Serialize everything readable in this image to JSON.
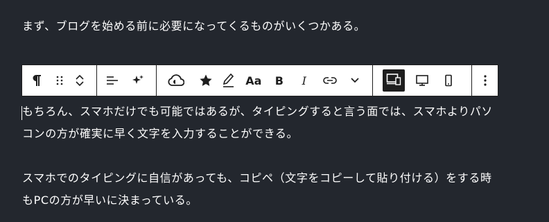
{
  "paragraphs": {
    "intro": "まず、ブログを始める前に必要になってくるものがいくつかある。",
    "p2_line1": "もちろん、スマホだけでも可能ではあるが、タイピングすると言う面では、スマホよりパソ",
    "p2_line2": "コンの方が確実に早く文字を入力することができる。",
    "p3_line1": "スマホでのタイピングに自信があっても、コピペ（文字をコピーして貼り付ける）をする時",
    "p3_line2": "もPCの方が早いに決まっている。"
  },
  "toolbar": {
    "case_label": "Aa",
    "bold_label": "B",
    "italic_label": "I",
    "icons": [
      "paragraph-icon",
      "drag-handle-icon",
      "move-up-icon",
      "move-down-icon",
      "align-icon",
      "ai-sparkle-icon",
      "cloud-icon",
      "star-icon",
      "highlighter-icon",
      "link-icon",
      "chevron-down-icon",
      "responsive-devices-icon",
      "desktop-icon",
      "mobile-icon",
      "more-options-icon"
    ]
  },
  "colors": {
    "background": "#23272e",
    "text": "#ffffff",
    "toolbar_bg": "#ffffff",
    "toolbar_fg": "#1e1e1e"
  }
}
